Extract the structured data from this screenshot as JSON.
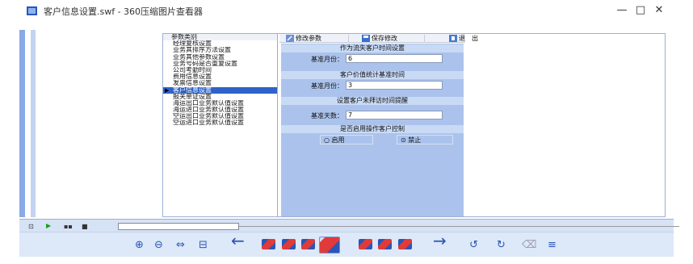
{
  "window": {
    "title": "客户信息设置.swf - 360压缩图片查看器",
    "controls": {
      "minimize": "—",
      "maximize": "□",
      "close": "✕"
    }
  },
  "tree": {
    "header": "参数类别",
    "items": [
      "经理复核设置",
      "业务其排序方法设置",
      "业务其他参数设置",
      "业务号码是否重复设置",
      "公司考勤时间",
      "费用信息设置",
      "发票信息设置",
      "客户信息设置",
      "报关单证设置",
      "海运出口业务默认值设置",
      "海运进口业务默认值设置",
      "空运出口业务默认值设置",
      "空运进口业务默认值设置"
    ],
    "selected_index": 7,
    "arrow": "▶"
  },
  "toolbar": {
    "modify": "修改参数",
    "save": "保存修改",
    "exit": "退　出"
  },
  "sections": [
    {
      "title": "作为流失客户时间设置",
      "label": "基准月份：",
      "value": "6"
    },
    {
      "title": "客户价值统计基准时间",
      "label": "基准月份：",
      "value": "3"
    },
    {
      "title": "设置客户未拜访时间提醒",
      "label": "基准天数：",
      "value": "7"
    }
  ],
  "control_section": {
    "title": "是否启用操作客户控制",
    "options": [
      "启用",
      "禁止"
    ],
    "selected": "禁止"
  },
  "radio_marks": {
    "off": "○",
    "on": "⊙"
  },
  "statusbar": {
    "icon": "⊡",
    "play": "▶",
    "pause": "▪▪",
    "stop": "■"
  },
  "bottombar": {
    "zoom_in": "⊕",
    "zoom_out": "⊖",
    "fit": "⇔",
    "actual": "⊟",
    "prev": "←",
    "next": "→",
    "rotate_left": "↺",
    "rotate_right": "↻",
    "delete": "⌫",
    "menu": "≡"
  },
  "colors": {
    "accent": "#2f63c8",
    "panel": "#abc3ec",
    "header": "#c9daf5"
  }
}
